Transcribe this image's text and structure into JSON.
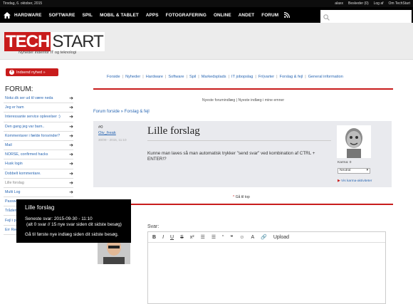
{
  "topbar": {
    "date": "Tirsdag, 6. oktober, 2015",
    "links": [
      "alaxx",
      "Beskeder (0)",
      "Log af",
      "Om TechStart"
    ]
  },
  "nav": {
    "items": [
      "HARDWARE",
      "SOFTWARE",
      "SPIL",
      "MOBIL & TABLET",
      "APPS",
      "FOTOGRAFERING",
      "ONLINE",
      "ANDET",
      "FORUM"
    ]
  },
  "search": {
    "placeholder": ""
  },
  "logo": {
    "tech": "TECH",
    "start": "START",
    "tagline": "Nyheder indenfor IT og teknologi"
  },
  "submit_news": "Indsend nyhed »",
  "forum_heading": "FORUM:",
  "sidebar": {
    "items": [
      "Nokz.dk ser ud til være neda",
      "Jeg er ham",
      "Interessante service oplevelser :)",
      "Den gang jeg var barn..",
      "Kommentarer i fælde forsvinder?",
      "Mail",
      "NORSE, confirmed hacks",
      "Husk login",
      "Dobbelt kommentare.",
      "Lille forslag",
      "Multi Log",
      "Password",
      "Tråden h",
      "Fejl i pop",
      "Err Redaktionen kender ikke til"
    ]
  },
  "forum_nav": [
    "Forside",
    "Nyheder",
    "Hardware",
    "Software",
    "Spil",
    "Markedsplads",
    "IT jobopslag",
    "Fri|varter",
    "Forslag & fejl",
    "General information"
  ],
  "post_links": "Nyeste forumindlæg | Nyeste indlæg i mine emner",
  "breadcrumb": "Forum forside » Forslag & fejl",
  "post": {
    "number": "#0",
    "author": "Oiv_freak",
    "date": "30/09 - 2015, 11:10",
    "title": "Lille forslag",
    "body": "Kunne man laves så man automatisk trykker \"send svar\" ved kombination af CTRL + ENTER!?",
    "karma_label": "Karma: 0",
    "karma_select": "Neutral",
    "see_karma": "Vis karma-aktiviteter"
  },
  "to_top": "Gå til top",
  "reply_label": "Svar:",
  "editor": {
    "toolbar": [
      "B",
      "I",
      "U",
      "S",
      "x²",
      "☰",
      "☰",
      "“",
      "❝",
      "☺",
      "A",
      "🔗",
      "Upload"
    ]
  },
  "tooltip": {
    "title": "Lille forslag",
    "line1": "Seneste svar: 2015-09-30 - 11:10",
    "line2": "(alt 0 svar  // 15 nye svar siden dit sidste besøg)",
    "line3": "Gå til første nye indlæg siden dit sidste besøg."
  }
}
